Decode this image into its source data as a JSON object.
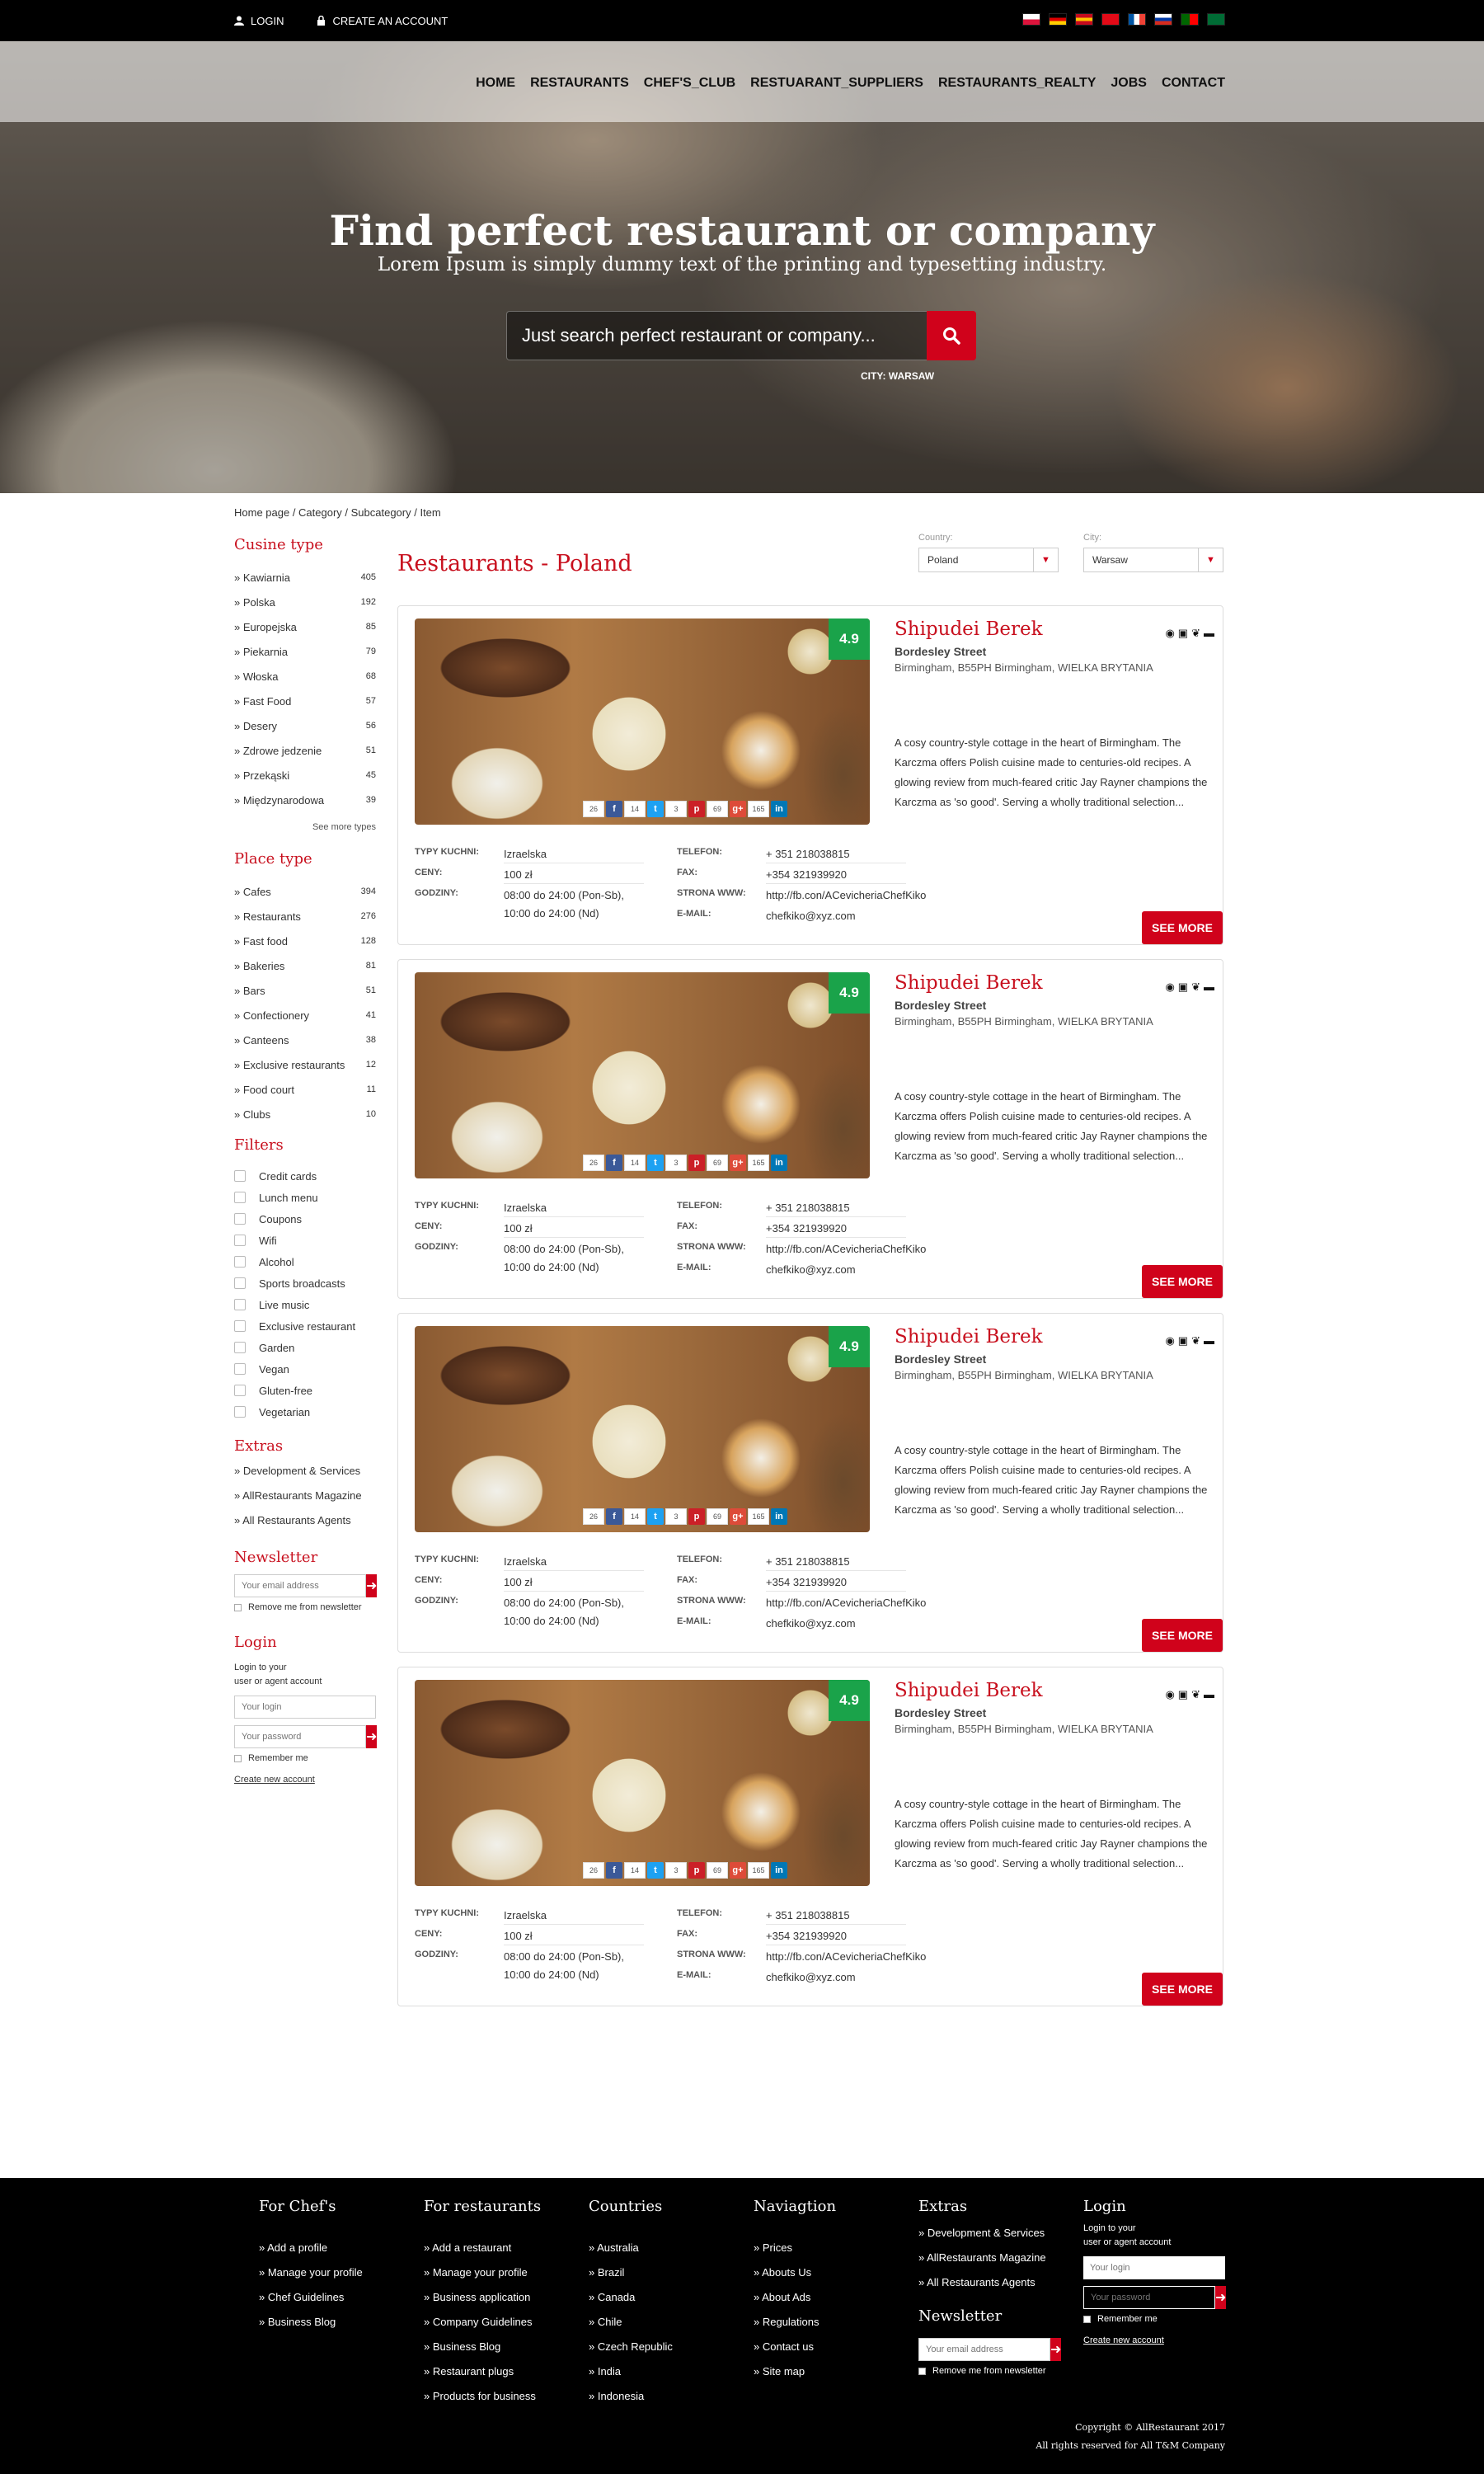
{
  "topbar": {
    "login": "LOGIN",
    "create_account": "CREATE AN ACCOUNT"
  },
  "flags": [
    {
      "name": "poland-flag",
      "colors": [
        "#ffffff",
        "#dc143c"
      ]
    },
    {
      "name": "germany-flag",
      "colors": [
        "#000000",
        "#dd0000",
        "#ffce00"
      ]
    },
    {
      "name": "spain-flag",
      "colors": [
        "#c60b1e",
        "#ffc400",
        "#c60b1e"
      ]
    },
    {
      "name": "turkey-flag",
      "colors": [
        "#e30a17",
        "#e30a17"
      ]
    },
    {
      "name": "france-flag",
      "colors": [
        "#0055a4",
        "#ffffff",
        "#ef4135"
      ]
    },
    {
      "name": "russia-flag",
      "colors": [
        "#ffffff",
        "#0039a6",
        "#d52b1e"
      ]
    },
    {
      "name": "portugal-flag",
      "colors": [
        "#006600",
        "#ff0000"
      ]
    },
    {
      "name": "saudi-flag",
      "colors": [
        "#006c35",
        "#006c35"
      ]
    }
  ],
  "nav": [
    "HOME",
    "RESTAURANTS",
    "CHEF'S_CLUB",
    "RESTUARANT_SUPPLIERS",
    "RESTAURANTS_REALTY",
    "JOBS",
    "CONTACT"
  ],
  "hero": {
    "title": "Find perfect restaurant or company",
    "subtitle": "Lorem Ipsum is simply dummy text of the printing and typesetting industry.",
    "search_placeholder": "Just search perfect restaurant or company...",
    "city": "CITY: WARSAW"
  },
  "breadcrumb": "Home page / Category / Subcategory / Item",
  "sidebar": {
    "cuisine_title": "Cusine type",
    "cuisine": [
      {
        "label": "» Kawiarnia",
        "count": "405"
      },
      {
        "label": "» Polska",
        "count": "192"
      },
      {
        "label": "» Europejska",
        "count": "85"
      },
      {
        "label": "» Piekarnia",
        "count": "79"
      },
      {
        "label": "» Włoska",
        "count": "68"
      },
      {
        "label": "» Fast Food",
        "count": "57"
      },
      {
        "label": "» Desery",
        "count": "56"
      },
      {
        "label": "» Zdrowe jedzenie",
        "count": "51"
      },
      {
        "label": "» Przekąski",
        "count": "45"
      },
      {
        "label": "» Międzynarodowa",
        "count": "39"
      }
    ],
    "see_more": "See more types",
    "place_title": "Place type",
    "places": [
      {
        "label": "» Cafes",
        "count": "394"
      },
      {
        "label": "» Restaurants",
        "count": "276"
      },
      {
        "label": "» Fast food",
        "count": "128"
      },
      {
        "label": "» Bakeries",
        "count": "81"
      },
      {
        "label": "» Bars",
        "count": "51"
      },
      {
        "label": "» Confectionery",
        "count": "41"
      },
      {
        "label": "» Canteens",
        "count": "38"
      },
      {
        "label": "» Exclusive restaurants",
        "count": "12"
      },
      {
        "label": "» Food court",
        "count": "11"
      },
      {
        "label": "» Clubs",
        "count": "10"
      }
    ],
    "filters_title": "Filters",
    "filters": [
      "Credit cards",
      "Lunch menu",
      "Coupons",
      "Wifi",
      "Alcohol",
      "Sports broadcasts",
      "Live music",
      "Exclusive restaurant",
      "Garden",
      "Vegan",
      "Gluten-free",
      "Vegetarian"
    ],
    "extras_title": "Extras",
    "extras": [
      "» Development & Services",
      "» AllRestaurants Magazine",
      "» All Restaurants Agents"
    ],
    "newsletter_title": "Newsletter",
    "newsletter_placeholder": "Your email address",
    "newsletter_remove": "Remove me from newsletter",
    "login_title": "Login",
    "login_hint1": "Login to your",
    "login_hint2": "user or agent account",
    "login_placeholder": "Your login",
    "password_placeholder": "Your password",
    "remember": "Remember me",
    "create": "Create new account"
  },
  "main": {
    "title": "Restaurants - Poland",
    "country_label": "Country:",
    "country_value": "Poland",
    "city_label": "City:",
    "city_value": "Warsaw"
  },
  "listing": {
    "rating": "4.9",
    "name": "Shipudei Berek",
    "street": "Bordesley Street",
    "city": "Birmingham, B55PH Birmingham, WIELKA BRYTANIA",
    "description": "A cosy country-style cottage in the heart of Birmingham. The Karczma offers Polish cuisine made to centuries-old recipes. A glowing review from much-feared critic Jay Rayner champions the Karczma as 'so good'. Serving a wholly traditional selection...",
    "social": [
      {
        "count": "26",
        "icon": "facebook-icon",
        "glyph": "f",
        "color": "#3b5998"
      },
      {
        "count": "14",
        "icon": "twitter-icon",
        "glyph": "t",
        "color": "#1da1f2"
      },
      {
        "count": "3",
        "icon": "pinterest-icon",
        "glyph": "p",
        "color": "#cb2027"
      },
      {
        "count": "69",
        "icon": "googleplus-icon",
        "glyph": "g+",
        "color": "#dd4b39"
      },
      {
        "count": "165",
        "icon": "linkedin-icon",
        "glyph": "in",
        "color": "#0077b5"
      }
    ],
    "cuisine_label": "TYPY KUCHNI:",
    "cuisine_value": "Izraelska",
    "price_label": "CENY:",
    "price_value": "100 zł",
    "hours_label": "GODZINY:",
    "hours_value1": "08:00 do 24:00 (Pon-Sb),",
    "hours_value2": "10:00 do 24:00 (Nd)",
    "phone_label": "TELEFON:",
    "phone_value": "+ 351 218038815",
    "fax_label": "FAX:",
    "fax_value": "+354 321939920",
    "www_label": "STRONA WWW:",
    "www_value": "http://fb.con/ACevicheriaChefKiko",
    "email_label": "E-MAIL:",
    "email_value": "chefkiko@xyz.com",
    "see_more": "SEE MORE"
  },
  "footer": {
    "chefs_title": "For Chef's",
    "chefs": [
      "» Add a profile",
      "» Manage your profile",
      "» Chef Guidelines",
      "» Business Blog"
    ],
    "rest_title": "For restaurants",
    "rest": [
      "» Add a restaurant",
      "» Manage your profile",
      "» Business application",
      "» Company Guidelines",
      "» Business Blog",
      "» Restaurant plugs",
      "» Products for business"
    ],
    "countries_title": "Countries",
    "countries": [
      "» Australia",
      "» Brazil",
      "» Canada",
      "» Chile",
      "» Czech Republic",
      "» India",
      "» Indonesia"
    ],
    "nav_title": "Naviagtion",
    "navs": [
      "» Prices",
      "» Abouts Us",
      "» About Ads",
      "» Regulations",
      "» Contact us",
      "» Site map"
    ],
    "extras_title": "Extras",
    "extras": [
      "» Development & Services",
      "» AllRestaurants Magazine",
      "» All Restaurants Agents"
    ],
    "newsletter_title": "Newsletter",
    "newsletter_placeholder": "Your email address",
    "newsletter_remove": "Remove me from newsletter",
    "login_title": "Login",
    "login_hint1": "Login to your",
    "login_hint2": "user or agent account",
    "login_placeholder": "Your login",
    "password_placeholder": "Your password",
    "remember": "Remember me",
    "create": "Create new account",
    "copyright1": "Copyright © AllRestaurant 2017",
    "copyright2": "All rights reserved for All T&M Company"
  }
}
